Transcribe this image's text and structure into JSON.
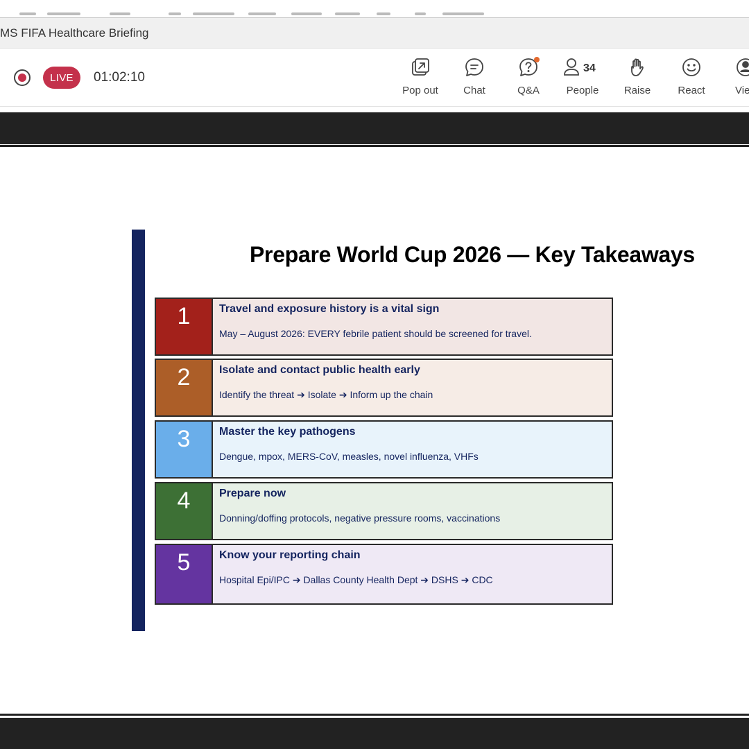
{
  "window": {
    "title": "MS FIFA Healthcare Briefing"
  },
  "meeting": {
    "live_label": "LIVE",
    "elapsed": "01:02:10",
    "people_count": "34"
  },
  "toolbar": {
    "buttons": [
      {
        "label": "Pop out",
        "icon": "pop-out-icon"
      },
      {
        "label": "Chat",
        "icon": "chat-icon"
      },
      {
        "label": "Q&A",
        "icon": "qa-icon"
      },
      {
        "label": "People",
        "icon": "people-icon"
      },
      {
        "label": "Raise",
        "icon": "raise-hand-icon"
      },
      {
        "label": "React",
        "icon": "react-icon"
      },
      {
        "label": "Vie",
        "icon": "view-icon"
      }
    ]
  },
  "slide": {
    "title": "Prepare World Cup 2026 — Key Takeaways",
    "takeaways": [
      {
        "number": "1",
        "heading": "Travel and exposure history is a vital sign",
        "detail": "May – August 2026: EVERY febrile patient should be screened for travel.",
        "color": "#a3211b",
        "bg": "#f2e6e4"
      },
      {
        "number": "2",
        "heading": "Isolate and contact public health early",
        "detail": "Identify the threat ➔ Isolate ➔ Inform up the chain",
        "color": "#ac5e28",
        "bg": "#f6ece6"
      },
      {
        "number": "3",
        "heading": "Master the key pathogens",
        "detail": "Dengue, mpox, MERS-CoV, measles, novel influenza, VHFs",
        "color": "#6aaeea",
        "bg": "#e8f3fb"
      },
      {
        "number": "4",
        "heading": "Prepare now",
        "detail": "Donning/doffing protocols, negative pressure rooms, vaccinations",
        "color": "#3d7035",
        "bg": "#e7f0e6"
      },
      {
        "number": "5",
        "heading": "Know your reporting chain",
        "detail": "Hospital Epi/IPC ➔ Dallas County Health Dept ➔ DSHS ➔ CDC",
        "color": "#6434a0",
        "bg": "#efe9f5"
      }
    ]
  },
  "colors": {
    "accent_bar": "#14245f",
    "live_red": "#c4314b",
    "qa_notification": "#e3692e",
    "stage_dark": "#222222"
  }
}
